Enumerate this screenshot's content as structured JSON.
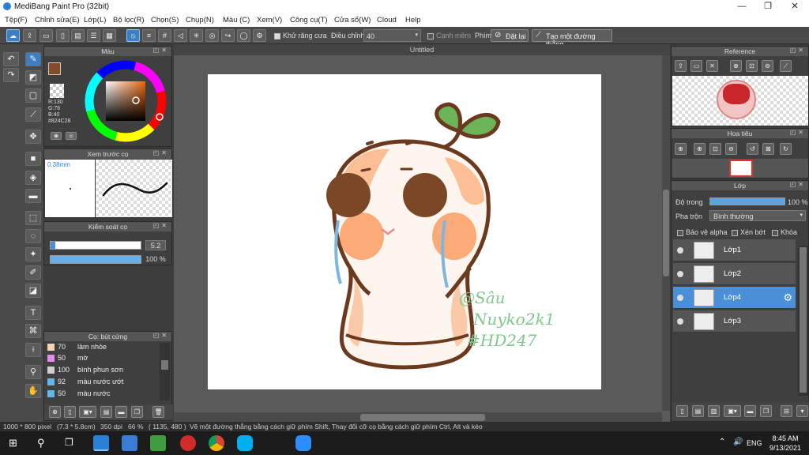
{
  "window": {
    "title": "MediBang Paint Pro (32bit)",
    "min": "—",
    "max": "❐",
    "close": "✕"
  },
  "menu": [
    "Tệp(F)",
    "Chỉnh sửa(E)",
    "Lớp(L)",
    "Bộ lọc(R)",
    "Chọn(S)",
    "Chụp(N)",
    "Màu (C)",
    "Xem(V)",
    "Công cụ(T)",
    "Cửa sổ(W)",
    "Cloud",
    "Help"
  ],
  "toolbar": {
    "antialias_label": "Khử răng cưa",
    "adjust_label": "Điều chỉnh",
    "adjust_value": "40",
    "edge_label": "Cạnh mềm",
    "key_label": "Phím",
    "reset_label": "Đặt lại",
    "straight_label": "Tạo một đường thẳng"
  },
  "color_panel": {
    "title": "Màu",
    "r": "R:130",
    "g": "G:76",
    "b": "B:40",
    "hex": "#824C28",
    "main_color": "#824C28"
  },
  "preview_panel": {
    "title": "Xem trước cọ",
    "size": "0.38mm"
  },
  "brush_control": {
    "title": "Kiểm soát cọ",
    "size_value": "5.2",
    "opacity_value": "100 %",
    "opacity_fraction": 1.0,
    "size_fraction": 0.05
  },
  "brush_list": {
    "title": "Cọ: bút cứng",
    "items": [
      {
        "size": "70",
        "name": "làm nhòe",
        "color": "#f5d4b0"
      },
      {
        "size": "50",
        "name": "mờ",
        "color": "#e58be8"
      },
      {
        "size": "100",
        "name": "bình phun sơn",
        "color": "#d0d0d0"
      },
      {
        "size": "92",
        "name": "màu nước ướt",
        "color": "#5fb8e8"
      },
      {
        "size": "50",
        "name": "màu nước",
        "color": "#5fb8e8"
      }
    ]
  },
  "canvas": {
    "tab": "Untitled",
    "signature_lines": [
      "@Sâu",
      "Nuyko2k1",
      "#HD247"
    ]
  },
  "reference_panel": {
    "title": "Reference"
  },
  "navigator_panel": {
    "title": "Hoa tiêu"
  },
  "layer_panel": {
    "title": "Lớp",
    "opacity_label": "Độ trong",
    "opacity_value": "100 %",
    "opacity_fraction": 1.0,
    "blend_label": "Pha trộn",
    "blend_value": "Bình thường",
    "protect_alpha": "Bảo vệ alpha",
    "clip": "Xén bớt",
    "lock": "Khóa",
    "layers": [
      {
        "name": "Lớp1",
        "selected": false
      },
      {
        "name": "Lớp2",
        "selected": false
      },
      {
        "name": "Lớp4",
        "selected": true
      },
      {
        "name": "Lớp3",
        "selected": false
      }
    ]
  },
  "status": {
    "size": "1000 * 800 pixel",
    "cm": "(7.3 * 5.8cm)",
    "dpi": "350 dpi",
    "zoom": "66 %",
    "coords": "( 1135, 480 )",
    "hint": "Vẽ một đường thẳng bằng cách giữ phím Shift, Thay đổi cỡ cọ bằng cách giữ phím Ctrl, Alt và kéo"
  },
  "taskbar": {
    "lang": "ENG",
    "time": "8:45 AM",
    "date": "9/13/2021"
  }
}
